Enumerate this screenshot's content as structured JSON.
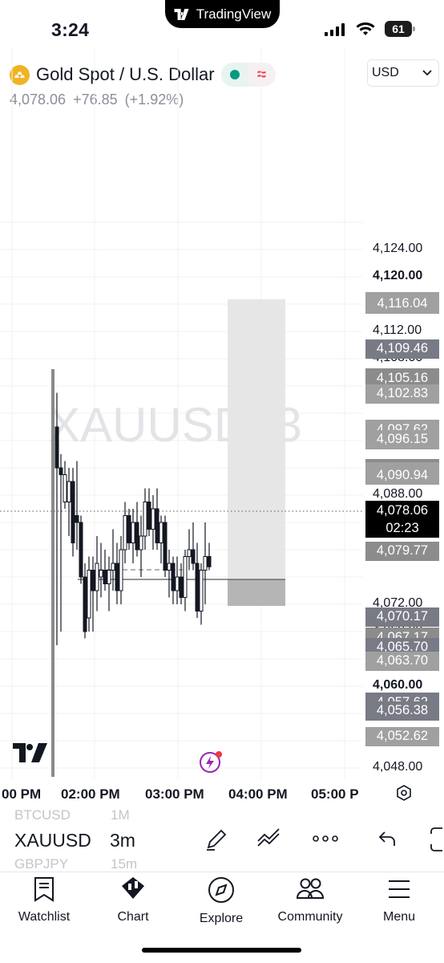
{
  "status_bar": {
    "time": "3:24",
    "battery": "61",
    "island_brand": "TradingView"
  },
  "header": {
    "symbol_title": "Gold Spot / U.S. Dollar",
    "price": "4,078.06",
    "change": "+76.85",
    "change_pct": "(+1.92%)",
    "currency": "USD"
  },
  "chart": {
    "watermark": "XAUUSD, 3",
    "current_price": "4,078.06",
    "countdown": "02:23",
    "axis_labels": [
      "4,124.00",
      "4,120.00",
      "4,112.00",
      "4,108.00",
      "4,088.00",
      "4,084.00",
      "4,072.00",
      "4,068.00",
      "4,060.00",
      "4,048.00"
    ],
    "axis_bold": [
      "4,120.00",
      "4,060.00"
    ],
    "price_labels": [
      {
        "value": "4,116.36",
        "color": "#a0a0a0"
      },
      {
        "value": "4,116.04",
        "color": "#a0a0a0"
      },
      {
        "value": "4,109.46",
        "color": "#787b86"
      },
      {
        "value": "4,105.16",
        "color": "#8c8c8c"
      },
      {
        "value": "4,102.83",
        "color": "#a0a0a0"
      },
      {
        "value": "4,097.62",
        "color": "#a0a0a0"
      },
      {
        "value": "4,096.15",
        "color": "#a0a0a0"
      },
      {
        "value": "4,091.85",
        "color": "#8c8c8c"
      },
      {
        "value": "4,091.42",
        "color": "#a0a0a0"
      },
      {
        "value": "4,090.94",
        "color": "#a0a0a0"
      },
      {
        "value": "4,079.77",
        "color": "#8c8c8c"
      },
      {
        "value": "4,070.17",
        "color": "#787b86"
      },
      {
        "value": "4,067.17",
        "color": "#8c8c8c"
      },
      {
        "value": "4,065.70",
        "color": "#787b86"
      },
      {
        "value": "4,063.70",
        "color": "#a0a0a0"
      },
      {
        "value": "4,057.62",
        "color": "#787b86"
      },
      {
        "value": "4,056.38",
        "color": "#787b86"
      },
      {
        "value": "4,052.62",
        "color": "#a0a0a0"
      }
    ],
    "time_labels": [
      "00 PM",
      "02:00 PM",
      "03:00 PM",
      "04:00 PM",
      "05:00 P"
    ]
  },
  "toolbar": {
    "symbol": "XAUUSD",
    "interval": "3m",
    "ghost_above": {
      "symbol": "BTCUSD",
      "interval": "1M"
    },
    "ghost_below": {
      "symbol": "GBPJPY",
      "interval": "15m"
    }
  },
  "tabs": [
    {
      "label": "Watchlist",
      "icon": "watchlist-icon"
    },
    {
      "label": "Chart",
      "icon": "chart-icon"
    },
    {
      "label": "Explore",
      "icon": "compass-icon"
    },
    {
      "label": "Community",
      "icon": "community-icon"
    },
    {
      "label": "Menu",
      "icon": "menu-icon"
    }
  ]
}
